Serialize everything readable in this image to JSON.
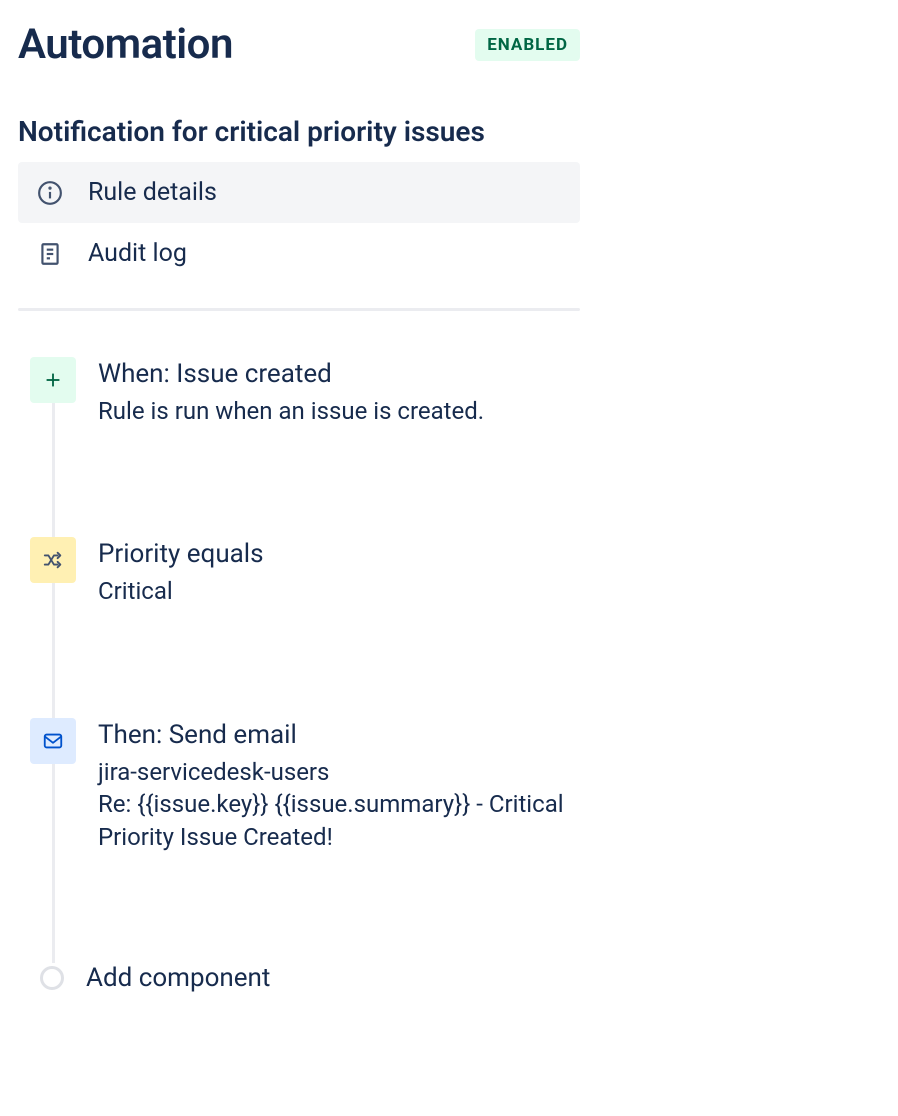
{
  "header": {
    "title": "Automation",
    "status": "ENABLED"
  },
  "rule": {
    "name": "Notification for critical priority issues"
  },
  "nav": {
    "details": "Rule details",
    "audit": "Audit log"
  },
  "steps": {
    "trigger": {
      "title": "When: Issue created",
      "desc": "Rule is run when an issue is created."
    },
    "condition": {
      "title": "Priority equals",
      "desc": "Critical"
    },
    "action": {
      "title": "Then: Send email",
      "desc": "jira-servicedesk-users\nRe: {{issue.key}} {{issue.summary}} - Critical Priority Issue Created!"
    }
  },
  "add_component": "Add component"
}
